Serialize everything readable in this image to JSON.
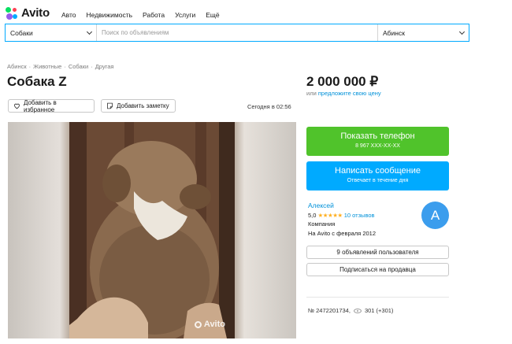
{
  "header": {
    "logo_text": "Avito",
    "nav": [
      "Авто",
      "Недвижимость",
      "Работа",
      "Услуги",
      "Ещё"
    ]
  },
  "search": {
    "category": "Собаки",
    "placeholder": "Поиск по объявлениям",
    "city": "Абинск"
  },
  "breadcrumbs": [
    "Абинск",
    "·",
    "Животные",
    "·",
    "Собаки",
    "·",
    "Другая"
  ],
  "listing": {
    "title": "Собака Z",
    "price": "2 000 000 ₽",
    "price_sub_prefix": "или",
    "price_sub_link": "предложите свою цену",
    "favorite_label": "Добавить в избранное",
    "note_label": "Добавить заметку",
    "date": "Сегодня в 02:56",
    "watermark": "Avito"
  },
  "contact": {
    "phone_label": "Показать телефон",
    "phone_number": "8 967 XXX-XX-XX",
    "message_label": "Написать сообщение",
    "message_sub": "Отвечает в течение дня"
  },
  "seller": {
    "name": "Алексей",
    "rating": "5,0",
    "stars": "★★★★★",
    "reviews": "10 отзывов",
    "type": "Компания",
    "since": "На Avito с февраля 2012",
    "avatar_letter": "A",
    "listings_label": "9 объявлений пользователя",
    "subscribe_label": "Подписаться на продавца"
  },
  "meta": {
    "id": "№ 2472201734,",
    "views": "301 (+301)"
  },
  "colors": {
    "accent": "#00aaff",
    "phone_button": "#50c32b",
    "link": "#0091d9",
    "avatar": "#3b9ded"
  }
}
